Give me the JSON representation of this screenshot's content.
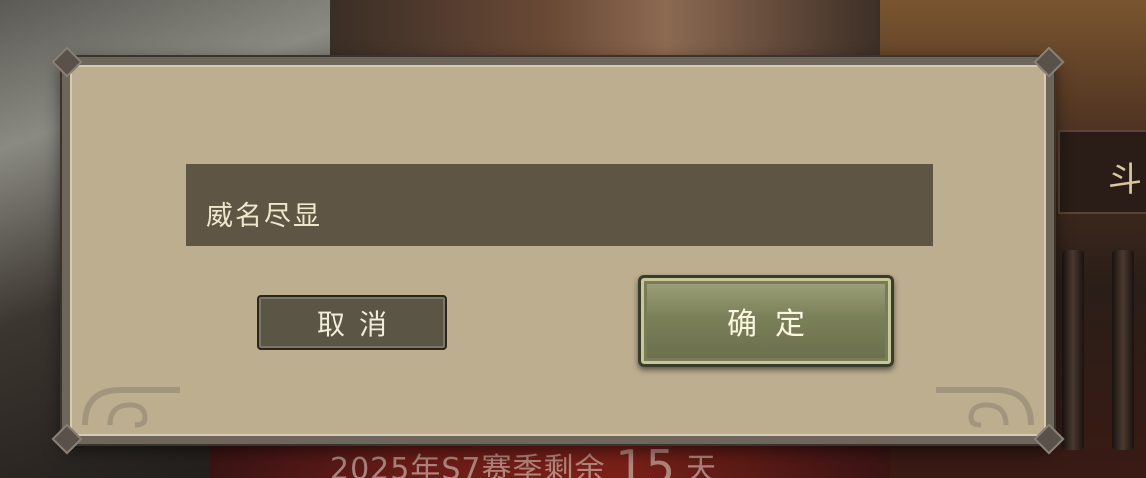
{
  "background": {
    "season_prefix": "2025年S7赛季剩余",
    "season_days": "15",
    "season_unit": "天",
    "side_tab_char": "斗"
  },
  "dialog": {
    "input_value": "威名尽显",
    "cancel_label": "取消",
    "confirm_label": "确定"
  },
  "colors": {
    "dialog_bg": "#bcae8e",
    "input_bg": "#5e5545",
    "confirm_bg": "#7a8058",
    "cancel_bg": "#5a5545"
  }
}
